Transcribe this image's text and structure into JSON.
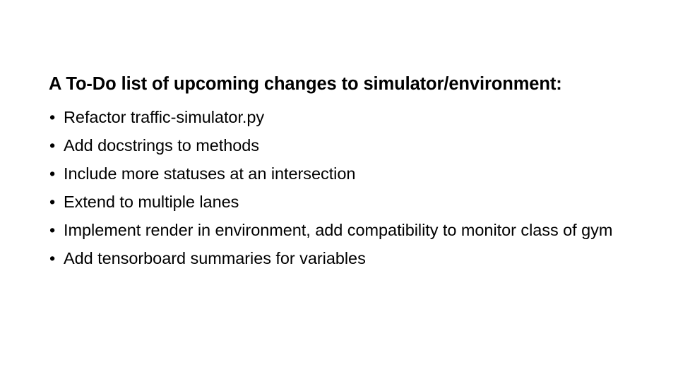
{
  "slide": {
    "title": "A To-Do list of upcoming changes to simulator/environment:",
    "bullet_glyph": "•",
    "bullets": [
      {
        "text": "Refactor traffic-simulator.py"
      },
      {
        "text": "Add docstrings to methods"
      },
      {
        "text": "Include more statuses at an intersection"
      },
      {
        "text": "Extend to multiple lanes"
      },
      {
        "text": "Implement render in environment, add compatibility to monitor class of gym"
      },
      {
        "text": "Add tensorboard summaries for variables"
      }
    ],
    "colors": {
      "background": "#ffffff",
      "text": "#000000"
    }
  }
}
